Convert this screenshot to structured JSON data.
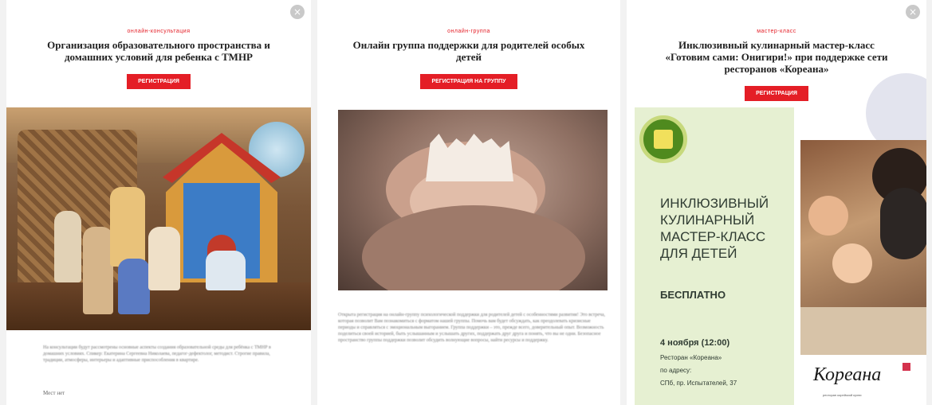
{
  "cards": [
    {
      "category": "онлайн-консультация",
      "title": "Организация образовательного пространства и домашних условий для ребенка с ТМНР",
      "button": "РЕГИСТРАЦИЯ",
      "close_icon": "×",
      "body": "На консультации будут рассмотрены основные аспекты создания образовательной среды для ребёнка с ТМНР в домашних условиях. Спикер: Екатерина Сергеевна Николаева, педагог-дефектолог, методист. Строгие правила, традиции, атмосферы, интерьеры и адаптивные приспособления в квартире.",
      "note": "Мест нет"
    },
    {
      "category": "онлайн-группа",
      "title": "Онлайн группа поддержки для родителей особых детей",
      "button": "РЕГИСТРАЦИЯ НА ГРУППУ",
      "body": "Открыта регистрация на онлайн-группу психологической поддержки для родителей детей с особенностями развития! Это встреча, которая позволит Вам познакомиться с форматом нашей группы. Помочь вам будет обсуждать, как преодолевать кризисные периоды и справляться с эмоциональным выгоранием. Группа поддержки – это, прежде всего, доверительный опыт. Возможность поделиться своей историей, быть услышанным и услышать других, поддержать друг друга и понять, что вы не одни. Безопасное пространство группы поддержки позволит обсудить волнующие вопросы, найти ресурсы и поддержку."
    },
    {
      "category": "мастер-класс",
      "title": "Инклюзивный кулинарный мастер-класс «Готовим сами: Онигири!» при поддержке сети ресторанов «Кореана»",
      "button": "РЕГИСТРАЦИЯ",
      "close_icon": "×",
      "poster": {
        "headline": "ИНКЛЮЗИВНЫЙ\nКУЛИНАРНЫЙ\nМАСТЕР-КЛАСС\nДЛЯ ДЕТЕЙ",
        "free": "БЕСПЛАТНО",
        "date": "4 ноября (12:00)",
        "venue": "Ресторан «Кореана»",
        "address_label": "по адресу:",
        "address": "СПб, пр. Испытателей, 37"
      },
      "logo": {
        "name": "Кореана",
        "sub": "ресторан корейской кухни"
      }
    }
  ],
  "colors": {
    "accent": "#e41e26",
    "poster_bg": "#e6f0d2",
    "poster_text": "#2f3b32",
    "icon_green": "#4f8a1e"
  },
  "icons": [
    "close-icon",
    "category-icon"
  ]
}
